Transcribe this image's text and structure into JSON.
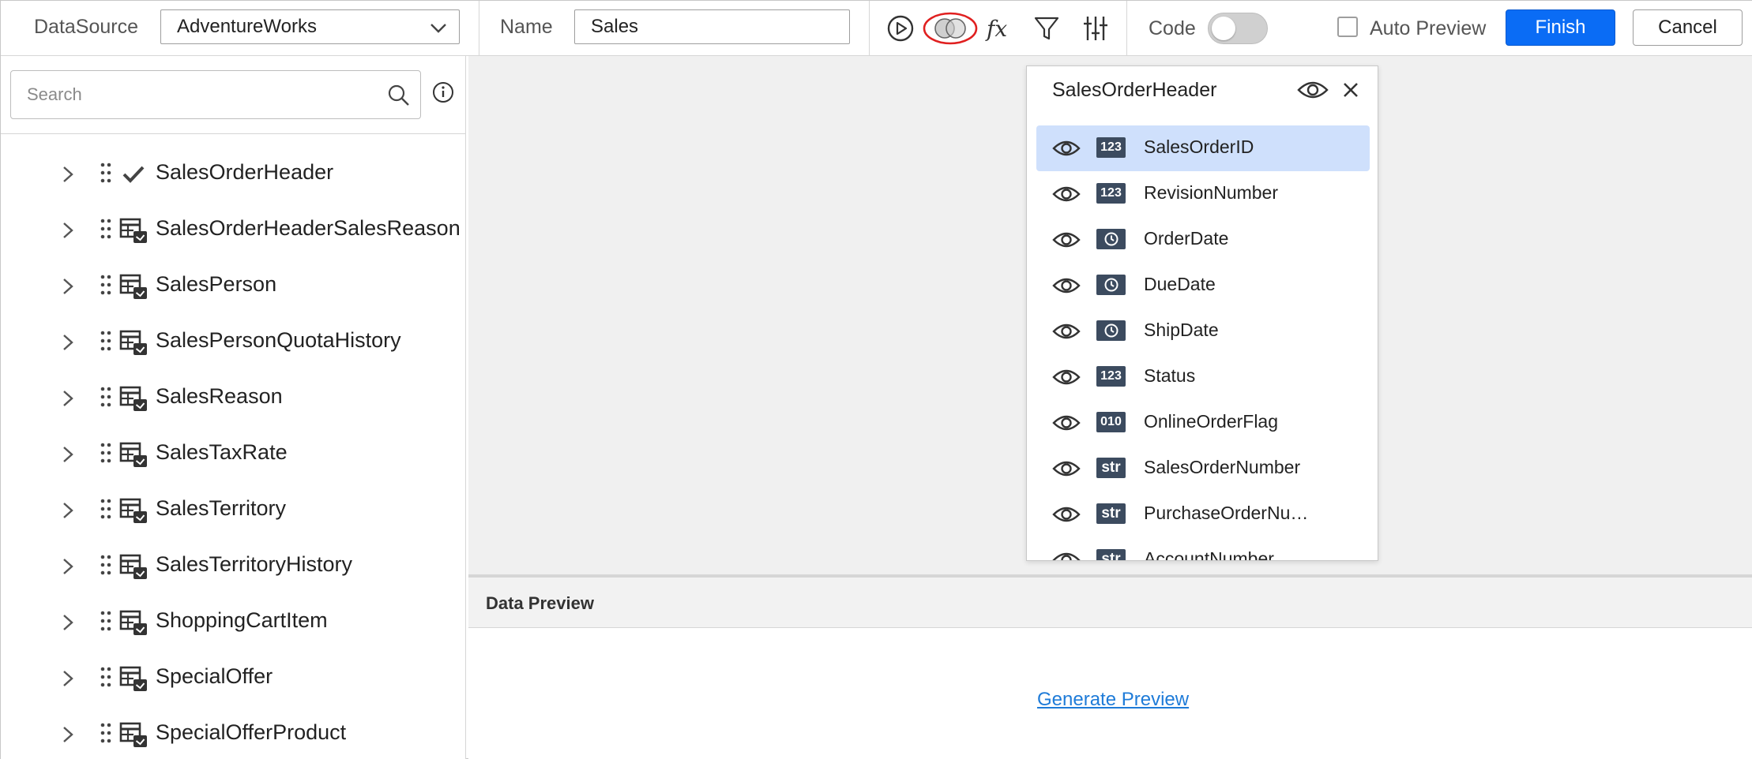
{
  "toolbar": {
    "datasource_label": "DataSource",
    "datasource_value": "AdventureWorks",
    "name_label": "Name",
    "name_value": "Sales",
    "code_label": "Code",
    "code_enabled": false,
    "auto_preview_label": "Auto Preview",
    "auto_preview_checked": false,
    "finish_label": "Finish",
    "cancel_label": "Cancel",
    "icons": [
      "play-icon",
      "join-icon",
      "fx-icon",
      "filter-icon",
      "sliders-icon"
    ],
    "join_icon_highlight": "#e02020"
  },
  "search": {
    "placeholder": "Search"
  },
  "tree": {
    "items": [
      {
        "label": "SalesOrderHeader",
        "icon": "check-icon"
      },
      {
        "label": "SalesOrderHeaderSalesReason",
        "icon": "table-icon"
      },
      {
        "label": "SalesPerson",
        "icon": "table-icon"
      },
      {
        "label": "SalesPersonQuotaHistory",
        "icon": "table-icon"
      },
      {
        "label": "SalesReason",
        "icon": "table-icon"
      },
      {
        "label": "SalesTaxRate",
        "icon": "table-icon"
      },
      {
        "label": "SalesTerritory",
        "icon": "table-icon"
      },
      {
        "label": "SalesTerritoryHistory",
        "icon": "table-icon"
      },
      {
        "label": "ShoppingCartItem",
        "icon": "table-icon"
      },
      {
        "label": "SpecialOffer",
        "icon": "table-icon"
      },
      {
        "label": "SpecialOfferProduct",
        "icon": "table-icon"
      }
    ]
  },
  "table_card": {
    "title": "SalesOrderHeader",
    "columns": [
      {
        "name": "SalesOrderID",
        "type": "123",
        "selected": true
      },
      {
        "name": "RevisionNumber",
        "type": "123"
      },
      {
        "name": "OrderDate",
        "type": "clock"
      },
      {
        "name": "DueDate",
        "type": "clock"
      },
      {
        "name": "ShipDate",
        "type": "clock"
      },
      {
        "name": "Status",
        "type": "123"
      },
      {
        "name": "OnlineOrderFlag",
        "type": "010"
      },
      {
        "name": "SalesOrderNumber",
        "type": "str"
      },
      {
        "name": "PurchaseOrderNu…",
        "type": "str"
      },
      {
        "name": "AccountNumber",
        "type": "str"
      }
    ]
  },
  "preview": {
    "title": "Data Preview",
    "generate_label": "Generate Preview"
  },
  "colors": {
    "accent": "#0a6cf5",
    "selected_row": "#cfe0fc",
    "badge": "#3c4b5f",
    "link": "#1e7bd8"
  }
}
